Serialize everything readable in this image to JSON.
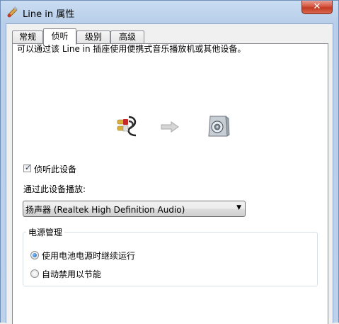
{
  "window": {
    "title": "Line in 属性",
    "close_label": "✕"
  },
  "tabs": [
    {
      "label": "常规",
      "active": false
    },
    {
      "label": "侦听",
      "active": true
    },
    {
      "label": "级别",
      "active": false
    },
    {
      "label": "高级",
      "active": false
    }
  ],
  "listen": {
    "description": "可以通过该 Line in 插座使用便携式音乐播放机或其他设备。",
    "listen_checkbox_label": "侦听此设备",
    "listen_checked": true,
    "playback_label": "通过此设备播放:",
    "playback_device": "扬声器 (Realtek High Definition Audio)",
    "dropdown_arrow": "▼"
  },
  "power": {
    "group_title": "电源管理",
    "options": [
      {
        "label": "使用电池电源时继续运行",
        "selected": true
      },
      {
        "label": "自动禁用以节能",
        "selected": false
      }
    ]
  },
  "icons": {
    "title": "speaker-settings-icon",
    "cable": "rca-cable-icon",
    "arrow": "arrow-right-icon",
    "speaker": "speaker-device-icon"
  }
}
